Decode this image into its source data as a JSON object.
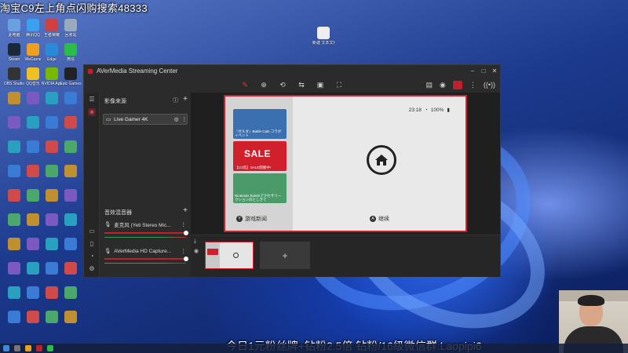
{
  "overlay": {
    "top_text": "淘宝C9左上角点闪购搜索48333",
    "bottom_text": "今日1元粉丝牌+钻粉2.5倍 钻粉/16级微信群:Laopipi6"
  },
  "desktop_icons": [
    {
      "label": "此电脑",
      "color": "#6aa0e0"
    },
    {
      "label": "腾讯QQ",
      "color": "#3aa0f0"
    },
    {
      "label": "王者荣耀",
      "color": "#d04040"
    },
    {
      "label": "回收站",
      "color": "#9ab"
    },
    {
      "label": "Steam",
      "color": "#1b2838"
    },
    {
      "label": "WeGame",
      "color": "#f0a020"
    },
    {
      "label": "Edge",
      "color": "#2a8ad8"
    },
    {
      "label": "微信",
      "color": "#2bbd4a"
    },
    {
      "label": "OBS Studio",
      "color": "#333"
    },
    {
      "label": "QQ音乐",
      "color": "#f0c020"
    },
    {
      "label": "NVIDIA App",
      "color": "#76b900"
    },
    {
      "label": "Epic Games",
      "color": "#222"
    },
    {
      "label": "新建 文本文档",
      "color": "#eee"
    }
  ],
  "app": {
    "title": "AVerMedia Streaming Center",
    "toolbar_icons": [
      "pen-icon",
      "zoom-icon",
      "rotate-icon",
      "flip-icon",
      "screenshot-icon",
      "fit-icon"
    ],
    "right_icons": [
      "layout-icon",
      "camera-icon",
      "record-icon",
      "more-icon",
      "stream-icon"
    ],
    "sources": {
      "header": "影像来源",
      "items": [
        {
          "name": "Live Gamer 4K"
        }
      ]
    },
    "mixer": {
      "header": "音效混音器",
      "channels": [
        {
          "name": "麦克风 (Yeti Stereo Mic...",
          "level": 0.97
        },
        {
          "name": "AVerMedia HD Capture...",
          "level": 0.97
        }
      ]
    },
    "preview": {
      "time": "23:18",
      "battery": "100%",
      "news_items": [
        {
          "caption": "『ゼルダ』Battle Cats コラボ イベント",
          "color": "#3a6fb0"
        },
        {
          "caption": "【1/3迄】SALE開催中!",
          "color": "#d0202c",
          "headline": "SALE"
        },
        {
          "caption": "Nintendo Switchアクセサリー クションのとしきて",
          "color": "#4a9a6a"
        }
      ],
      "news_button_label": "游戏新闻",
      "news_button_glyph": "Y",
      "continue_label": "继续",
      "continue_glyph": "A"
    },
    "scene_add_label": "+"
  }
}
